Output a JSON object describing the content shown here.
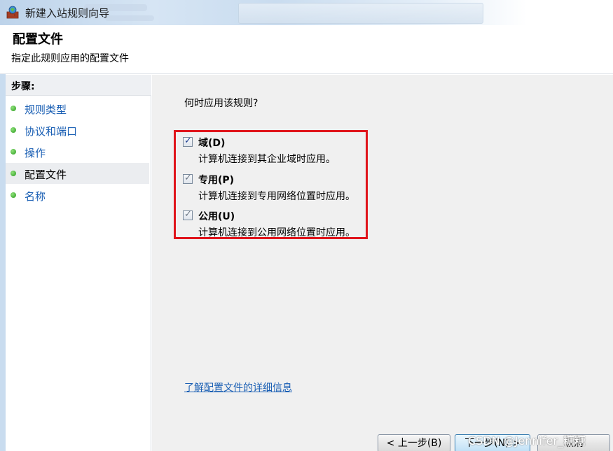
{
  "window": {
    "title": "新建入站规则向导",
    "icon": "firewall-wizard-icon"
  },
  "header": {
    "title": "配置文件",
    "subtitle": "指定此规则应用的配置文件"
  },
  "steps": {
    "heading": "步骤:",
    "items": [
      {
        "label": "规则类型",
        "active": false
      },
      {
        "label": "协议和端口",
        "active": false
      },
      {
        "label": "操作",
        "active": false
      },
      {
        "label": "配置文件",
        "active": true
      },
      {
        "label": "名称",
        "active": false
      }
    ]
  },
  "main": {
    "question": "何时应用该规则?",
    "options": [
      {
        "name": "域(D)",
        "description": "计算机连接到其企业域时应用。",
        "checked": true
      },
      {
        "name": "专用(P)",
        "description": "计算机连接到专用网络位置时应用。",
        "checked": true
      },
      {
        "name": "公用(U)",
        "description": "计算机连接到公用网络位置时应用。",
        "checked": true
      }
    ],
    "learn_more_link": "了解配置文件的详细信息"
  },
  "buttons": {
    "back": "< 上一步(B)",
    "next": "下一步(N) >",
    "cancel": "取消"
  },
  "watermark": "CSDN @Jennifer_糖糖",
  "colors": {
    "highlight_border": "#e0141b",
    "link": "#1a5fb4",
    "step_dot": "#2b9a1e"
  }
}
